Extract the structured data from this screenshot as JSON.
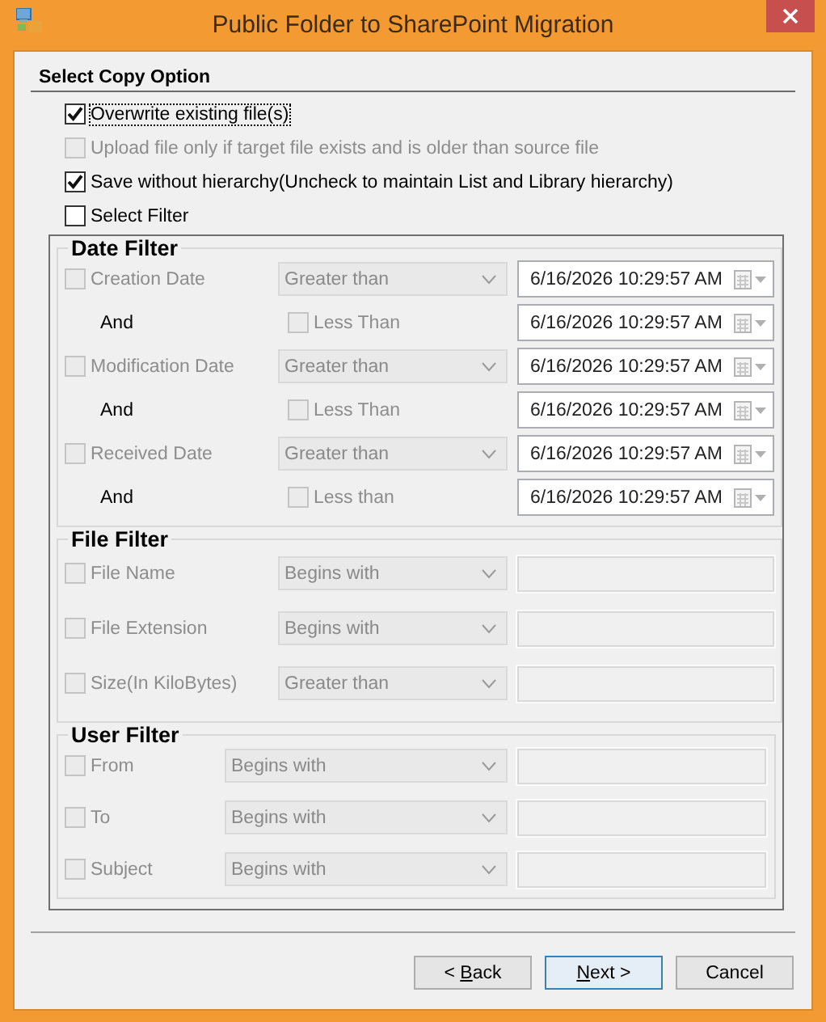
{
  "window": {
    "title": "Public Folder to SharePoint Migration"
  },
  "section_title": "Select Copy Option",
  "options": [
    {
      "label": "Overwrite existing file(s)",
      "checked": true,
      "disabled": false,
      "focused": true
    },
    {
      "label": "Upload file only if target file exists and is older than source file",
      "checked": false,
      "disabled": true,
      "focused": false
    },
    {
      "label": "Save without hierarchy(Uncheck to maintain List and Library hierarchy)",
      "checked": true,
      "disabled": false,
      "focused": false
    },
    {
      "label": "Select Filter",
      "checked": false,
      "disabled": false,
      "focused": false
    }
  ],
  "filter_groups": [
    {
      "title": "Date Filter",
      "kind": "date",
      "rows": [
        {
          "kind": "main",
          "label": "Creation Date",
          "checked": false,
          "disabled": true,
          "operator": "Greater than",
          "value": "6/16/2026 10:29:57 AM"
        },
        {
          "kind": "and",
          "label": "And",
          "check_label": "Less Than",
          "checked": false,
          "disabled": true,
          "value": "6/16/2026 10:29:57 AM"
        },
        {
          "kind": "main",
          "label": "Modification Date",
          "checked": false,
          "disabled": true,
          "operator": "Greater than",
          "value": "6/16/2026 10:29:57 AM"
        },
        {
          "kind": "and",
          "label": "And",
          "check_label": "Less Than",
          "checked": false,
          "disabled": true,
          "value": "6/16/2026 10:29:57 AM"
        },
        {
          "kind": "main",
          "label": "Received Date",
          "checked": false,
          "disabled": true,
          "operator": "Greater than",
          "value": "6/16/2026 10:29:57 AM"
        },
        {
          "kind": "and",
          "label": "And",
          "check_label": "Less than",
          "checked": false,
          "disabled": true,
          "value": "6/16/2026 10:29:57 AM"
        }
      ]
    },
    {
      "title": "File Filter",
      "kind": "text",
      "rows": [
        {
          "kind": "main",
          "label": "File Name",
          "checked": false,
          "disabled": true,
          "operator": "Begins with"
        },
        {
          "kind": "main",
          "label": "File Extension",
          "checked": false,
          "disabled": true,
          "operator": "Begins with"
        },
        {
          "kind": "main",
          "label": "Size(In KiloBytes)",
          "checked": false,
          "disabled": true,
          "operator": "Greater than"
        }
      ]
    },
    {
      "title": "User Filter",
      "kind": "user",
      "rows": [
        {
          "kind": "main",
          "label": "From",
          "checked": false,
          "disabled": true,
          "operator": "Begins with"
        },
        {
          "kind": "main",
          "label": "To",
          "checked": false,
          "disabled": true,
          "operator": "Begins with"
        },
        {
          "kind": "main",
          "label": "Subject",
          "checked": false,
          "disabled": true,
          "operator": "Begins with"
        }
      ]
    }
  ],
  "buttons": [
    {
      "before": "< ",
      "key": "B",
      "after": "ack",
      "default": false
    },
    {
      "key": "N",
      "after": "ext >",
      "default": true
    },
    {
      "after": "Cancel",
      "default": false
    }
  ]
}
